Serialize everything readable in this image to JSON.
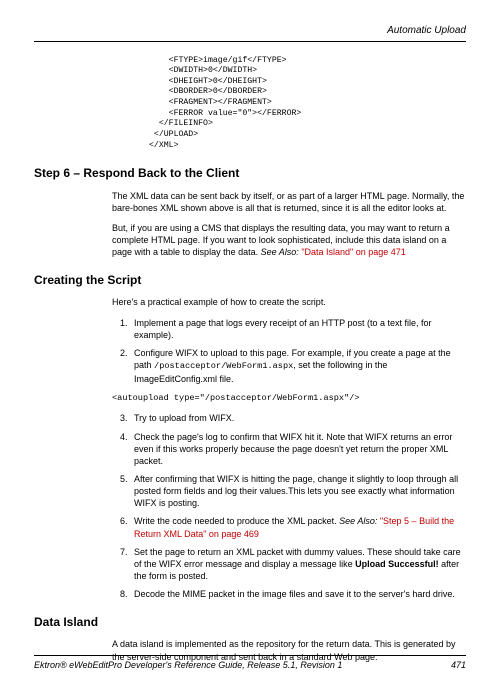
{
  "header": {
    "section": "Automatic Upload"
  },
  "code_top": "    <FTYPE>image/gif</FTYPE>\n    <DWIDTH>0</DWIDTH>\n    <DHEIGHT>0</DHEIGHT>\n    <DBORDER>0</DBORDER>\n    <FRAGMENT></FRAGMENT>\n    <FERROR value=\"0\"></FERROR>\n  </FILEINFO>\n </UPLOAD>\n</XML>",
  "step6": {
    "heading": "Step 6 – Respond Back to the Client",
    "p1": "The XML data can be sent back by itself, or as part of a larger HTML page. Normally, the bare-bones XML shown above is all that is returned, since it is all the editor looks at.",
    "p2_a": "But, if you are using a CMS that displays the resulting data, you may want to return a complete HTML page. If you want to look sophisticated, include this data island on a page with a table to display the data. ",
    "p2_see": "See Also: ",
    "p2_link1": "\"Data Island\" on page 471"
  },
  "creating": {
    "heading": "Creating the Script",
    "intro": "Here's a practical example of how to create the script.",
    "items": {
      "i1": "Implement a page that logs every receipt of an HTTP post (to a text file, for example).",
      "i2_a": "Configure WIFX to upload to this page. For example, if you create a page at the path ",
      "i2_code": "/postacceptor/WebForm1.aspx",
      "i2_b": ", set the following in the ImageEditConfig.xml file.",
      "i2_standalone": "<autoupload type=\"/postacceptor/WebForm1.aspx\"/>",
      "i3": "Try to upload from WIFX.",
      "i4": "Check the page's log to confirm that WIFX hit it. Note that WIFX returns an error even if this works properly because the page doesn't yet return the proper XML packet.",
      "i5": "After confirming that WIFX is hitting the page, change it slightly to loop through all posted form fields and log their values.This lets you see exactly what information WIFX is posting.",
      "i6_a": "Write the code needed to produce the XML packet. ",
      "i6_see": "See Also: ",
      "i6_link": "\"Step 5 – Build the Return XML Data\" on page 469",
      "i7_a": "Set the page to return an XML packet with dummy values. These should take care of the WIFX error message and display a message like ",
      "i7_bold": "Upload Successful!",
      "i7_b": " after the form is posted.",
      "i8": "Decode the MIME packet in the image files and save it to the server's hard drive."
    }
  },
  "data_island": {
    "heading": "Data Island",
    "p1": "A data island is implemented as the repository for the return data. This is generated by the server-side component and sent back in a standard Web page."
  },
  "footer": {
    "text": "Ektron® eWebEditPro Developer's Reference Guide, Release 5.1, Revision 1",
    "page": "471"
  }
}
